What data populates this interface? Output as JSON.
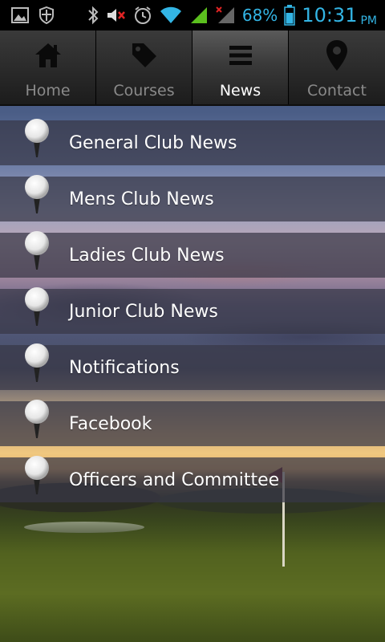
{
  "status_bar": {
    "battery_percent": "68%",
    "time": "10:31",
    "ampm": "PM",
    "icons": [
      "gallery-icon",
      "shield-icon",
      "bluetooth-icon",
      "mute-icon",
      "alarm-icon",
      "wifi-icon",
      "signal-icon",
      "no-signal-icon",
      "battery-icon"
    ],
    "accent_color": "#33b5e5"
  },
  "tabs": [
    {
      "label": "Home",
      "icon": "home-icon",
      "active": false
    },
    {
      "label": "Courses",
      "icon": "tag-icon",
      "active": false
    },
    {
      "label": "News",
      "icon": "menu-icon",
      "active": true
    },
    {
      "label": "Contact",
      "icon": "location-pin-icon",
      "active": false
    }
  ],
  "menu": {
    "item_icon": "golf-ball-icon",
    "items": [
      {
        "label": "General Club News"
      },
      {
        "label": "Mens Club News"
      },
      {
        "label": "Ladies Club News"
      },
      {
        "label": "Junior Club News"
      },
      {
        "label": "Notifications"
      },
      {
        "label": "Facebook"
      },
      {
        "label": "Officers and Committee"
      }
    ]
  }
}
